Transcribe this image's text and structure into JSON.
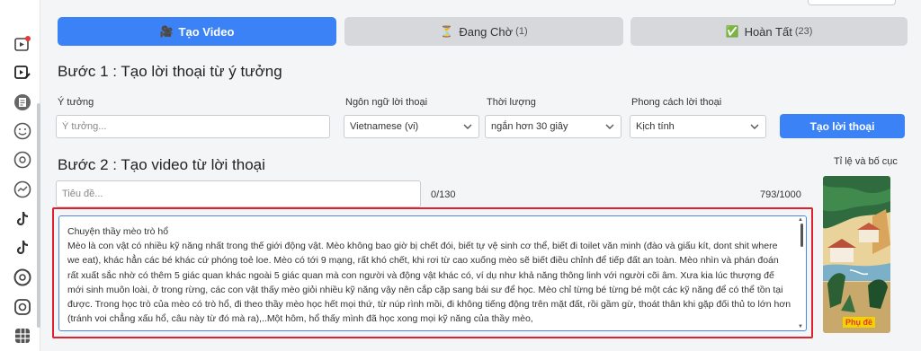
{
  "tabs": {
    "create": {
      "label": "Tạo Video"
    },
    "pending": {
      "label": "Đang Chờ",
      "count": "(1)"
    },
    "done": {
      "label": "Hoàn Tất",
      "count": "(23)"
    }
  },
  "step1": {
    "title": "Bước 1 : Tạo lời thoại từ ý tưởng",
    "idea_label": "Ý tưởng",
    "idea_placeholder": "Ý tưởng...",
    "idea_value": "",
    "language_label": "Ngôn ngữ lời thoại",
    "language_value": "Vietnamese (vi)",
    "duration_label": "Thời lượng",
    "duration_value": "ngắn hơn 30 giây",
    "style_label": "Phong cách lời thoại",
    "style_value": "Kịch tính",
    "generate_button": "Tạo lời thoại"
  },
  "step2": {
    "title": "Bước 2 : Tạo video từ lời thoại",
    "title_placeholder": "Tiêu đề...",
    "title_value": "",
    "title_counter": "0/130",
    "script_counter": "793/1000",
    "script_text": "Chuyện thầy mèo trò hổ\nMèo là con vật có nhiều kỹ năng nhất trong thế giới động vật. Mèo không bao giờ bị chết đói, biết tự vệ sinh cơ thể, biết đi toilet văn minh (đào và giấu kít, dont shit where we eat), khác hẳn các bé khác cứ phóng toẻ loe. Mèo có tới 9 mạng, rất khó chết, khi rơi từ cao xuống mèo sẽ biết điều chỉnh để tiếp đất an toàn. Mèo nhìn và phán đoán rất xuất sắc nhờ có thêm 5 giác quan khác ngoài 5 giác quan mà con người và động vật khác có, ví dụ như khả năng thông linh với người cõi âm. Xưa kia lúc thượng đế mới sinh muôn loài, ở trong rừng, các con vật thấy mèo giỏi nhiều kỹ năng vậy nên cắp cặp sang bái sư để học. Mèo chỉ từng bé từng bé một các kỹ năng để có thể tồn tại được. Trong học trò của mèo có trò hổ, đi theo thầy mèo học hết mọi thứ, từ núp rình mồi, đi không tiếng động trên mặt đất, rồi gầm gừ, thoát thân khi gặp đối thủ to lớn hơn (tránh voi chẳng xấu hổ, câu này từ đó mà ra),..Một hôm, hổ thấy mình đã học xong mọi kỹ năng của thầy mèo,",
    "ratio_label": "Tỉ lệ và bố cục",
    "thumbnail_caption": "Phụ đề"
  },
  "sidebar": {
    "icons": [
      "video-add-icon",
      "video-edit-icon",
      "document-icon",
      "smiley-icon",
      "music-disc-icon",
      "trend-icon",
      "tiktok-icon",
      "tiktok-icon",
      "threads-icon",
      "instagram-icon",
      "grid-icon"
    ]
  },
  "colors": {
    "accent": "#3b82f6",
    "highlight_border": "#e0212d",
    "caption_bg": "#f2d200"
  }
}
